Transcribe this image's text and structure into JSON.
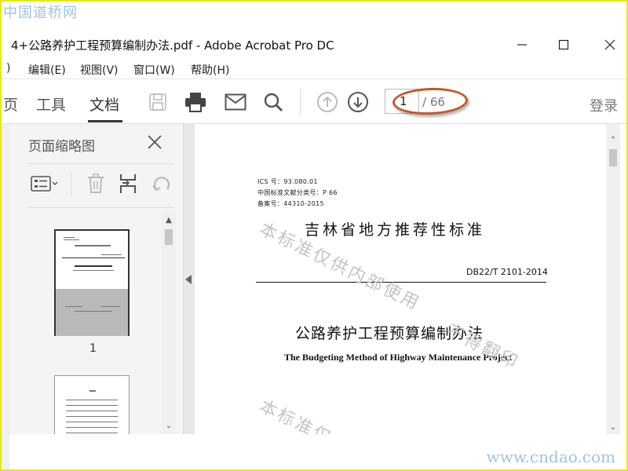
{
  "watermarks": {
    "site_top": "中国道桥网",
    "site_bottom": "www.cndao.com",
    "diagonal_1": "本标准仅供内部使用",
    "diagonal_2": "不得翻印",
    "diagonal_3": "本标准仅"
  },
  "window": {
    "title": "4+公路养护工程预算编制办法.pdf - Adobe Acrobat Pro DC",
    "controls": [
      "minimize-icon",
      "maximize-icon",
      "close-icon"
    ]
  },
  "menu": {
    "partial": ")",
    "items": [
      "编辑(E)",
      "视图(V)",
      "窗口(W)",
      "帮助(H)"
    ]
  },
  "toolbar": {
    "partial_tab": "页",
    "tabs": [
      "工具",
      "文档"
    ],
    "active_tab": "文档",
    "icons": [
      "save-icon",
      "print-icon",
      "email-icon",
      "search-icon",
      "page-up-icon",
      "page-down-icon"
    ],
    "page_current": "1",
    "page_total": "/ 66",
    "login": "登录"
  },
  "sidebar": {
    "title": "页面缩略图",
    "tools": [
      "thumbnail-options-icon",
      "delete-page-icon",
      "insert-page-icon",
      "rotate-page-icon"
    ],
    "thumbnails": [
      {
        "label": "1",
        "selected": true
      },
      {
        "label": "",
        "selected": false
      }
    ]
  },
  "document": {
    "meta_lines": [
      "ICS 号：93.080.01",
      "中国标准文献分类号：P 66",
      "备案号：44310-2015"
    ],
    "heading": "吉林省地方推荐性标准",
    "code": "DB22/T 2101-2014",
    "title": "公路养护工程预算编制办法",
    "subtitle": "The Budgeting Method of Highway Maintenance Project"
  },
  "colors": {
    "frame": "#e8e800",
    "annotation_circle": "#c05a2b",
    "site_watermark": "#9ec4e0"
  }
}
